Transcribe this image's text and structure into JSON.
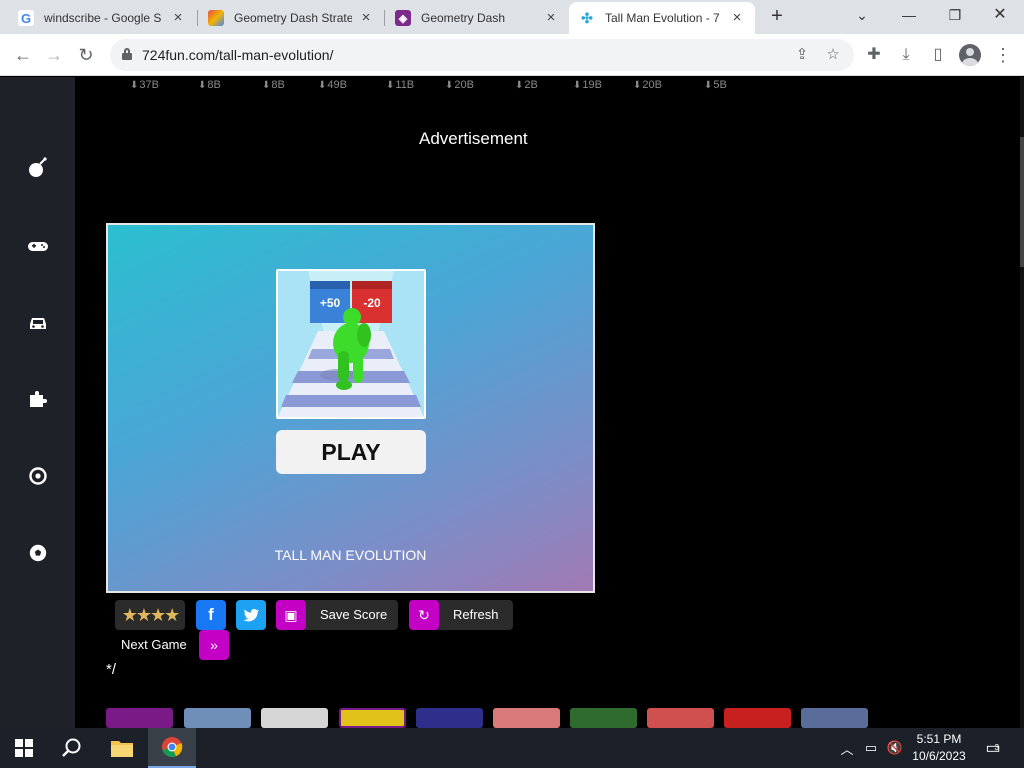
{
  "browser": {
    "tabs": [
      {
        "title": "windscribe - Google S",
        "favicon": "google-icon",
        "active": false
      },
      {
        "title": "Geometry Dash Strate",
        "favicon": "site-icon",
        "active": false
      },
      {
        "title": "Geometry Dash",
        "favicon": "geometry-dash-icon",
        "active": false
      },
      {
        "title": "Tall Man Evolution - 7",
        "favicon": "724fun-icon",
        "active": true
      }
    ],
    "url": "724fun.com/tall-man-evolution/"
  },
  "downloads_row": [
    "37B",
    "8B",
    "8B",
    "49B",
    "11B",
    "20B",
    "2B",
    "19B",
    "20B",
    "5B"
  ],
  "sidebar": {
    "icons": [
      "bomb-icon",
      "gamepad-icon",
      "car-icon",
      "puzzle-icon",
      "target-icon",
      "soccer-ball-icon"
    ]
  },
  "ad_label": "Advertisement",
  "game": {
    "gate_left": "+50",
    "gate_right": "-20",
    "play_label": "PLAY",
    "title": "TALL MAN EVOLUTION"
  },
  "actions": {
    "rating": 4,
    "save_label": "Save Score",
    "refresh_label": "Refresh",
    "next_label": "Next Game"
  },
  "stray_text": "*/",
  "more_games_colors": [
    "#7a1a86",
    "#6f8fb8",
    "#d6d6d6",
    "#e0c21a",
    "#2d2f8a",
    "#d87a7a",
    "#2f6b2f",
    "#d05050",
    "#c81f1f",
    "#5a6c9a"
  ],
  "taskbar": {
    "time": "5:51 PM",
    "date": "10/6/2023",
    "notifications": "3"
  },
  "colors": {
    "sidebar_bg": "#1e2228",
    "accent": "#c400c4",
    "facebook": "#1877f2",
    "twitter": "#1da1f2"
  }
}
